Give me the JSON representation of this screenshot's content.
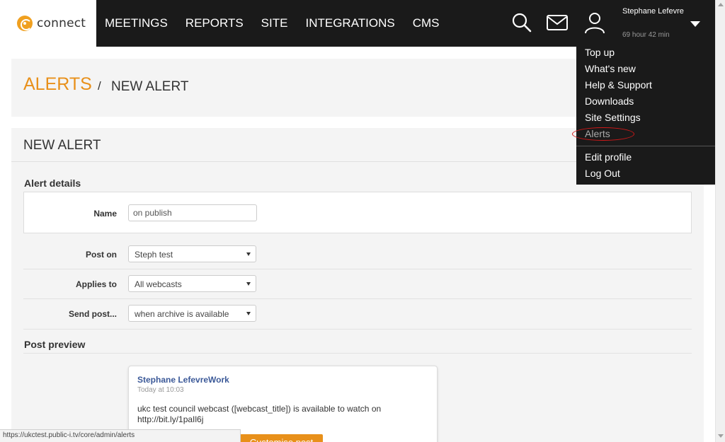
{
  "brand": {
    "logo_text": "connect",
    "accent_color": "#e8901a",
    "nav_bg": "#1a1a1a"
  },
  "nav": {
    "items": [
      "MEETINGS",
      "REPORTS",
      "SITE",
      "INTEGRATIONS",
      "CMS"
    ],
    "icons": [
      "search-icon",
      "mail-icon",
      "user-icon"
    ]
  },
  "user": {
    "name": "Stephane Lefevre",
    "session_time": "69 hour 42 min"
  },
  "user_menu": {
    "items": [
      "Top up",
      "What's new",
      "Help & Support",
      "Downloads",
      "Site Settings",
      "Alerts"
    ],
    "footer_items": [
      "Edit profile",
      "Log Out"
    ],
    "highlighted": "Alerts"
  },
  "breadcrumb": {
    "section": "ALERTS",
    "separator": "/",
    "current": "NEW ALERT"
  },
  "form": {
    "title": "NEW ALERT",
    "details_title": "Alert details",
    "name": {
      "label": "Name",
      "value": "on publish"
    },
    "post_on": {
      "label": "Post on",
      "value": "Steph test"
    },
    "applies_to": {
      "label": "Applies to",
      "value": "All webcasts"
    },
    "send_post": {
      "label": "Send post...",
      "value": "when archive is available"
    },
    "preview_title": "Post preview"
  },
  "preview": {
    "author": "Stephane LefevreWork",
    "time": "Today at 10:03",
    "text": "ukc test council webcast ([webcast_title]) is available to watch on http://bit.ly/1paIl6j",
    "customise_button": "Customise post"
  },
  "statusbar": {
    "url": "https://ukctest.public-i.tv/core/admin/alerts"
  }
}
